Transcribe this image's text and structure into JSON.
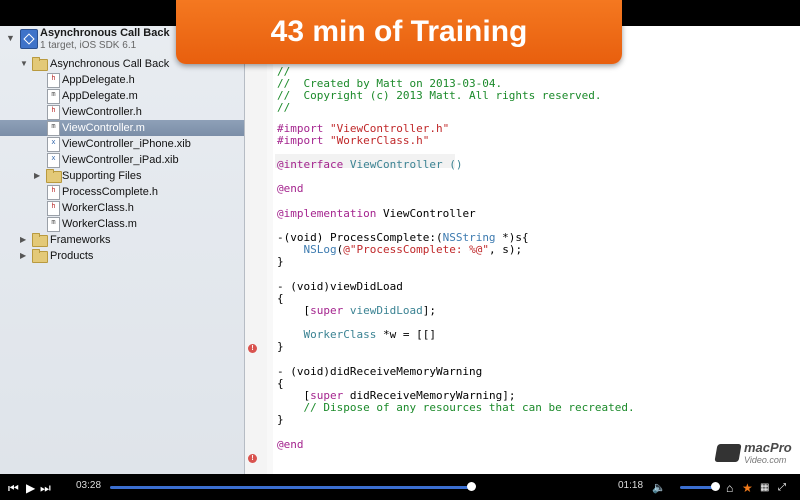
{
  "banner": {
    "text": "43 min of Training"
  },
  "project": {
    "name": "Asynchronous Call Back",
    "subtitle": "1 target, iOS SDK 6.1"
  },
  "navigator": [
    {
      "label": "Asynchronous Call Back",
      "kind": "folder",
      "level": 1,
      "open": true
    },
    {
      "label": "AppDelegate.h",
      "kind": "h",
      "level": 2
    },
    {
      "label": "AppDelegate.m",
      "kind": "m",
      "level": 2
    },
    {
      "label": "ViewController.h",
      "kind": "h",
      "level": 2
    },
    {
      "label": "ViewController.m",
      "kind": "m",
      "level": 2,
      "selected": true
    },
    {
      "label": "ViewController_iPhone.xib",
      "kind": "x",
      "level": 2
    },
    {
      "label": "ViewController_iPad.xib",
      "kind": "x",
      "level": 2
    },
    {
      "label": "Supporting Files",
      "kind": "folder",
      "level": 2,
      "open": false
    },
    {
      "label": "ProcessComplete.h",
      "kind": "h",
      "level": 2
    },
    {
      "label": "WorkerClass.h",
      "kind": "h",
      "level": 2
    },
    {
      "label": "WorkerClass.m",
      "kind": "m",
      "level": 2
    },
    {
      "label": "Frameworks",
      "kind": "folder",
      "level": 1,
      "open": false
    },
    {
      "label": "Products",
      "kind": "folder",
      "level": 1,
      "open": false
    }
  ],
  "code": {
    "c1": "//",
    "c2": "//  Created by Matt on 2013-03-04.",
    "c3": "//  Copyright (c) 2013 Matt. All rights reserved.",
    "c4": "//",
    "import_kw": "#import",
    "imp1": "\"ViewController.h\"",
    "imp2": "\"WorkerClass.h\"",
    "interface_kw": "@interface",
    "interface_name": "ViewController ()",
    "end1": "@end",
    "impl_kw": "@implementation",
    "impl_name": "ViewController",
    "m1_a": "-(void) ProcessComplete:(",
    "m1_type": "NSString",
    "m1_b": " *)s{",
    "log_fn": "NSLog",
    "log_a": "(",
    "log_str": "@\"ProcessComplete: %@\"",
    "log_b": ", s);",
    "brace_close": "}",
    "m2": "- (void)viewDidLoad",
    "brace_open": "{",
    "super_open": "[",
    "super_kw": "super",
    "super_call": "viewDidLoad",
    "super_close": "];",
    "worker_type": "WorkerClass",
    "worker_rest": " *w = [[]",
    "m3": "- (void)didReceiveMemoryWarning",
    "super2_rest": " didReceiveMemoryWarning];",
    "dispose_comment": "// Dispose of any resources that can be recreated.",
    "end2": "@end"
  },
  "player": {
    "elapsed": "03:28",
    "remaining": "01:18",
    "progress": 0.99
  },
  "watermark": {
    "line1": "macPro",
    "line2": "Video.com"
  }
}
